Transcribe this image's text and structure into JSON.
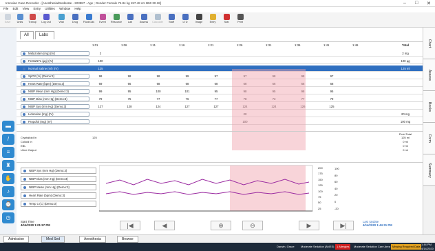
{
  "window": {
    "title": "Innovian Case Recorder - [Anesthesia/Moderate - 223987 - Age ; Gender Female 74.84 kg 157.48 cm BMI 30.18]",
    "minimize": "–",
    "maximize": "□",
    "close": "✕"
  },
  "menu": [
    "File",
    "Edit",
    "View",
    "Entry",
    "Utilities",
    "Window",
    "Help"
  ],
  "toolbar": [
    "Save",
    "Units",
    "Transp",
    "Log Out",
    "Vital",
    "Drug",
    "Fluid/Gas",
    "Event",
    "Resource",
    "Lab",
    "Assess",
    "Calculate",
    "Staff",
    "LTD",
    "Image",
    "Entry",
    "Stat",
    "Print"
  ],
  "tabs": {
    "all": "All",
    "labs": "Labs"
  },
  "times": [
    "1:01",
    "1:06",
    "1:11",
    "1:16",
    "1:21",
    "1:26",
    "1:31",
    "1:36",
    "1:41",
    "1:46"
  ],
  "total_header": "Total",
  "rows": [
    {
      "label": "Midazolam (mg) (IV)",
      "cells": [
        "2",
        "",
        "",
        "",
        "",
        "",
        "",
        "",
        "",
        ""
      ],
      "total": "2 mg"
    },
    {
      "label": "FentaNYL (µg) (IV)",
      "cells": [
        "100",
        "",
        "",
        "",
        "",
        "",
        "",
        "",
        "",
        ""
      ],
      "total": "100 µg"
    },
    {
      "label": "Normal Saline (ml) (IV)",
      "cells": [
        "125",
        "",
        "",
        "",
        "",
        "",
        "",
        "",
        "",
        ""
      ],
      "total": "125 ml"
    },
    {
      "label": "SpO2 (%) (Demo:3)",
      "cells": [
        "98",
        "98",
        "98",
        "99",
        "97",
        "97",
        "98",
        "98",
        "97",
        ""
      ],
      "total": ""
    },
    {
      "label": "Heart Rate (bpm) (Demo:3)",
      "cells": [
        "69",
        "66",
        "68",
        "68",
        "68",
        "68",
        "66",
        "66",
        "68",
        ""
      ],
      "total": ""
    },
    {
      "label": "NIBP Mean (mm Hg) (Demo:3)",
      "cells": [
        "99",
        "95",
        "100",
        "101",
        "95",
        "98",
        "95",
        "98",
        "95",
        ""
      ],
      "total": ""
    },
    {
      "label": "NIBP Dias (mm Hg) (Demo:3)",
      "cells": [
        "79",
        "75",
        "77",
        "76",
        "77",
        "78",
        "73",
        "77",
        "79",
        ""
      ],
      "total": ""
    },
    {
      "label": "NIBP Sys (mm Hg) (Demo:3)",
      "cells": [
        "127",
        "128",
        "124",
        "127",
        "127",
        "124",
        "124",
        "126",
        "125",
        ""
      ],
      "total": ""
    },
    {
      "label": "Lidocaine (mg) (IV)",
      "cells": [
        "",
        "",
        "",
        "",
        "",
        "20",
        "",
        "",
        "",
        ""
      ],
      "total": "20 mg"
    },
    {
      "label": "Propofol (mg) (IV)",
      "cells": [
        "",
        "",
        "",
        "",
        "",
        "100",
        "",
        "",
        "",
        ""
      ],
      "total": "100 mg"
    }
  ],
  "summary": {
    "header": "Fluid Total",
    "rows": [
      {
        "label": "Crystalloid In",
        "value": "125",
        "total": "125 ml"
      },
      {
        "label": "Colloid In",
        "value": "",
        "total": "0 ml"
      },
      {
        "label": "EBL",
        "value": "",
        "total": "0 ml"
      },
      {
        "label": "Urine Output",
        "value": "",
        "total": "0 ml"
      }
    ]
  },
  "legend": [
    "NIBP Sys (mm Hg) (Demo:3)",
    "NIBP Dias (mm Hg) (Demo:3)",
    "NIBP Mean (mm Hg) (Demo:3)",
    "Heart Rate (bpm) (Demo:3)",
    "Temp 1 (C) (Demo:3)"
  ],
  "axis_right_1": [
    "200",
    "175",
    "150",
    "125",
    "100",
    "75",
    "50",
    "25"
  ],
  "axis_right_2": [
    "100",
    "80",
    "60",
    "40",
    "20",
    "0",
    "-20"
  ],
  "start": {
    "label": "Start Time",
    "value": "4/14/2020 1:01:57 PM"
  },
  "last": {
    "label": "Last Update",
    "value": "4/14/2020 1:44:31 PM"
  },
  "right_tabs": [
    "Chart",
    "Assess",
    "Books",
    "Form",
    "Summary"
  ],
  "bottom_tabs": [
    "Admission",
    "Med Sed",
    "Anesthesia",
    "Browse"
  ],
  "status": {
    "user": "Darwin, Grace",
    "sed": "Moderate Sedation (ANES)",
    "alert": "1 Allergies",
    "area": "Moderate Sedation Care Area",
    "required": "Missing Required Data",
    "time": "1:44 PM",
    "date": "4/14/2020"
  }
}
